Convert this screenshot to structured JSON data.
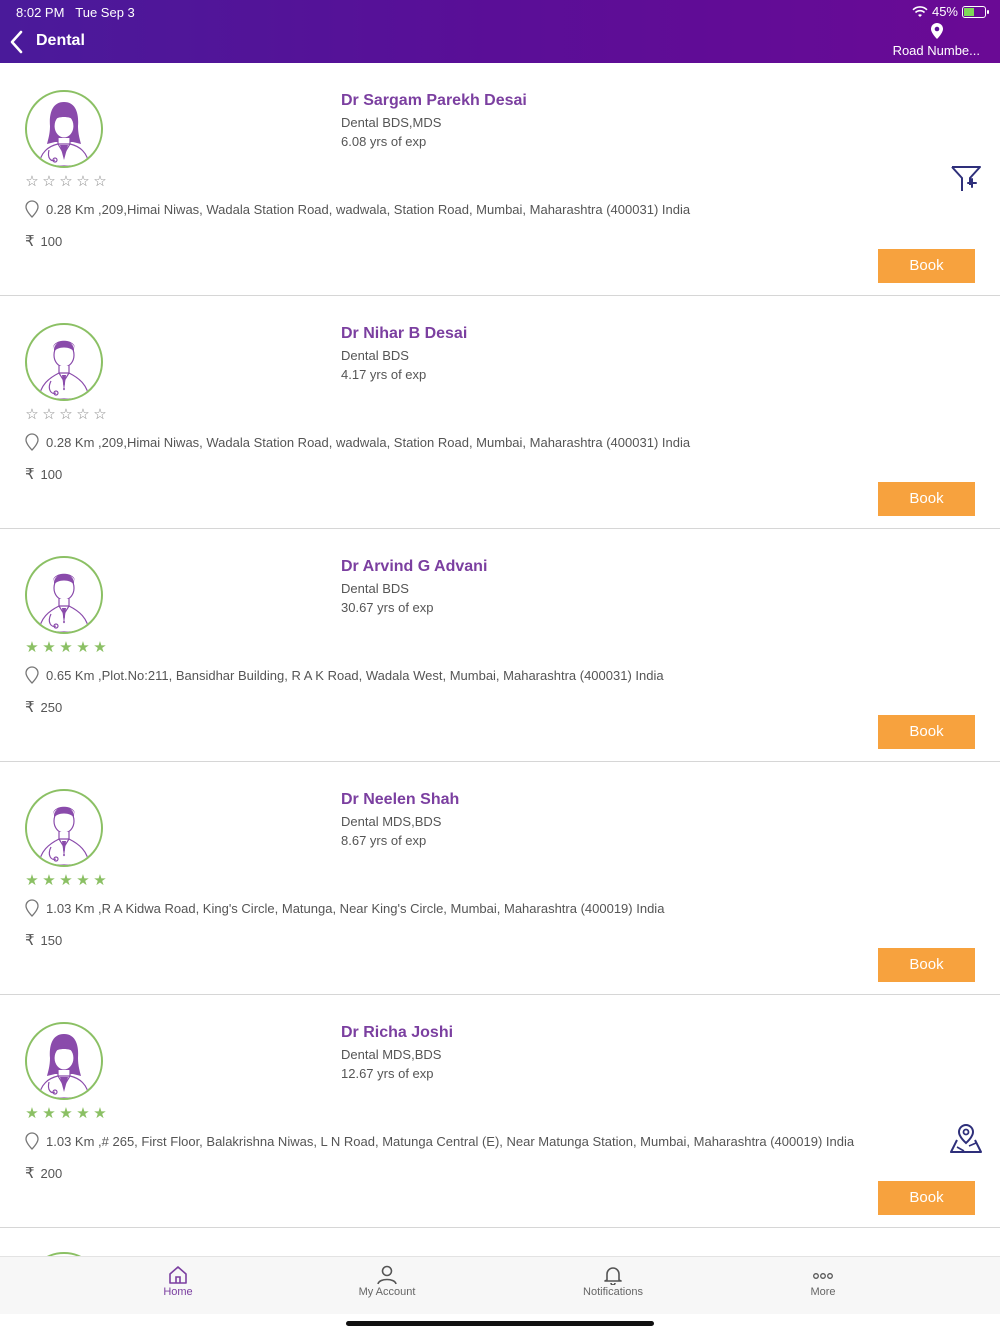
{
  "status_bar": {
    "time": "8:02 PM",
    "date": "Tue Sep 3",
    "battery": "45%"
  },
  "header": {
    "title": "Dental",
    "location": "Road Numbe..."
  },
  "doctors": [
    {
      "name": "Dr Sargam Parekh Desai",
      "specialty": "Dental  BDS,MDS",
      "experience": "6.08 yrs of exp",
      "rating": 0,
      "gender": "female",
      "address": "0.28 Km ,209,Himai Niwas, Wadala Station Road, wadwala, Station Road, Mumbai, Maharashtra (400031) India",
      "fee": "100",
      "book_label": "Book"
    },
    {
      "name": "Dr Nihar B Desai",
      "specialty": "Dental  BDS",
      "experience": "4.17 yrs of exp",
      "rating": 0,
      "gender": "male",
      "address": "0.28 Km ,209,Himai Niwas, Wadala Station Road, wadwala, Station Road, Mumbai, Maharashtra (400031) India",
      "fee": "100",
      "book_label": "Book"
    },
    {
      "name": "Dr Arvind G Advani",
      "specialty": "Dental  BDS",
      "experience": "30.67 yrs of exp",
      "rating": 5,
      "gender": "male",
      "address": "0.65 Km ,Plot.No:211, Bansidhar Building, R A K Road, Wadala West, Mumbai, Maharashtra (400031) India",
      "fee": "250",
      "book_label": "Book"
    },
    {
      "name": "Dr Neelen Shah",
      "specialty": "Dental  MDS,BDS",
      "experience": "8.67 yrs of exp",
      "rating": 5,
      "gender": "male",
      "address": "1.03 Km ,R A Kidwa Road, King's Circle, Matunga, Near King's Circle, Mumbai, Maharashtra (400019) India",
      "fee": "150",
      "book_label": "Book"
    },
    {
      "name": "Dr Richa Joshi",
      "specialty": "Dental  MDS,BDS",
      "experience": "12.67 yrs of exp",
      "rating": 5,
      "gender": "female",
      "address": "1.03 Km ,# 265, First Floor, Balakrishna Niwas, L N Road, Matunga Central (E), Near Matunga Station, Mumbai, Maharashtra (400019) India",
      "fee": "200",
      "book_label": "Book"
    }
  ],
  "currency_symbol": "₹",
  "tabs": [
    {
      "label": "Home",
      "icon": "home-icon",
      "active": true
    },
    {
      "label": "My Account",
      "icon": "user-icon",
      "active": false
    },
    {
      "label": "Notifications",
      "icon": "bell-icon",
      "active": false
    },
    {
      "label": "More",
      "icon": "more-icon",
      "active": false
    }
  ],
  "colors": {
    "header_start": "#4a1a9a",
    "header_end": "#6a0a95",
    "accent_name": "#7b3fa0",
    "book_button": "#f7a23e",
    "avatar_ring": "#8bc064",
    "star_filled": "#8bc064",
    "icon_navy": "#2e2f7a"
  }
}
